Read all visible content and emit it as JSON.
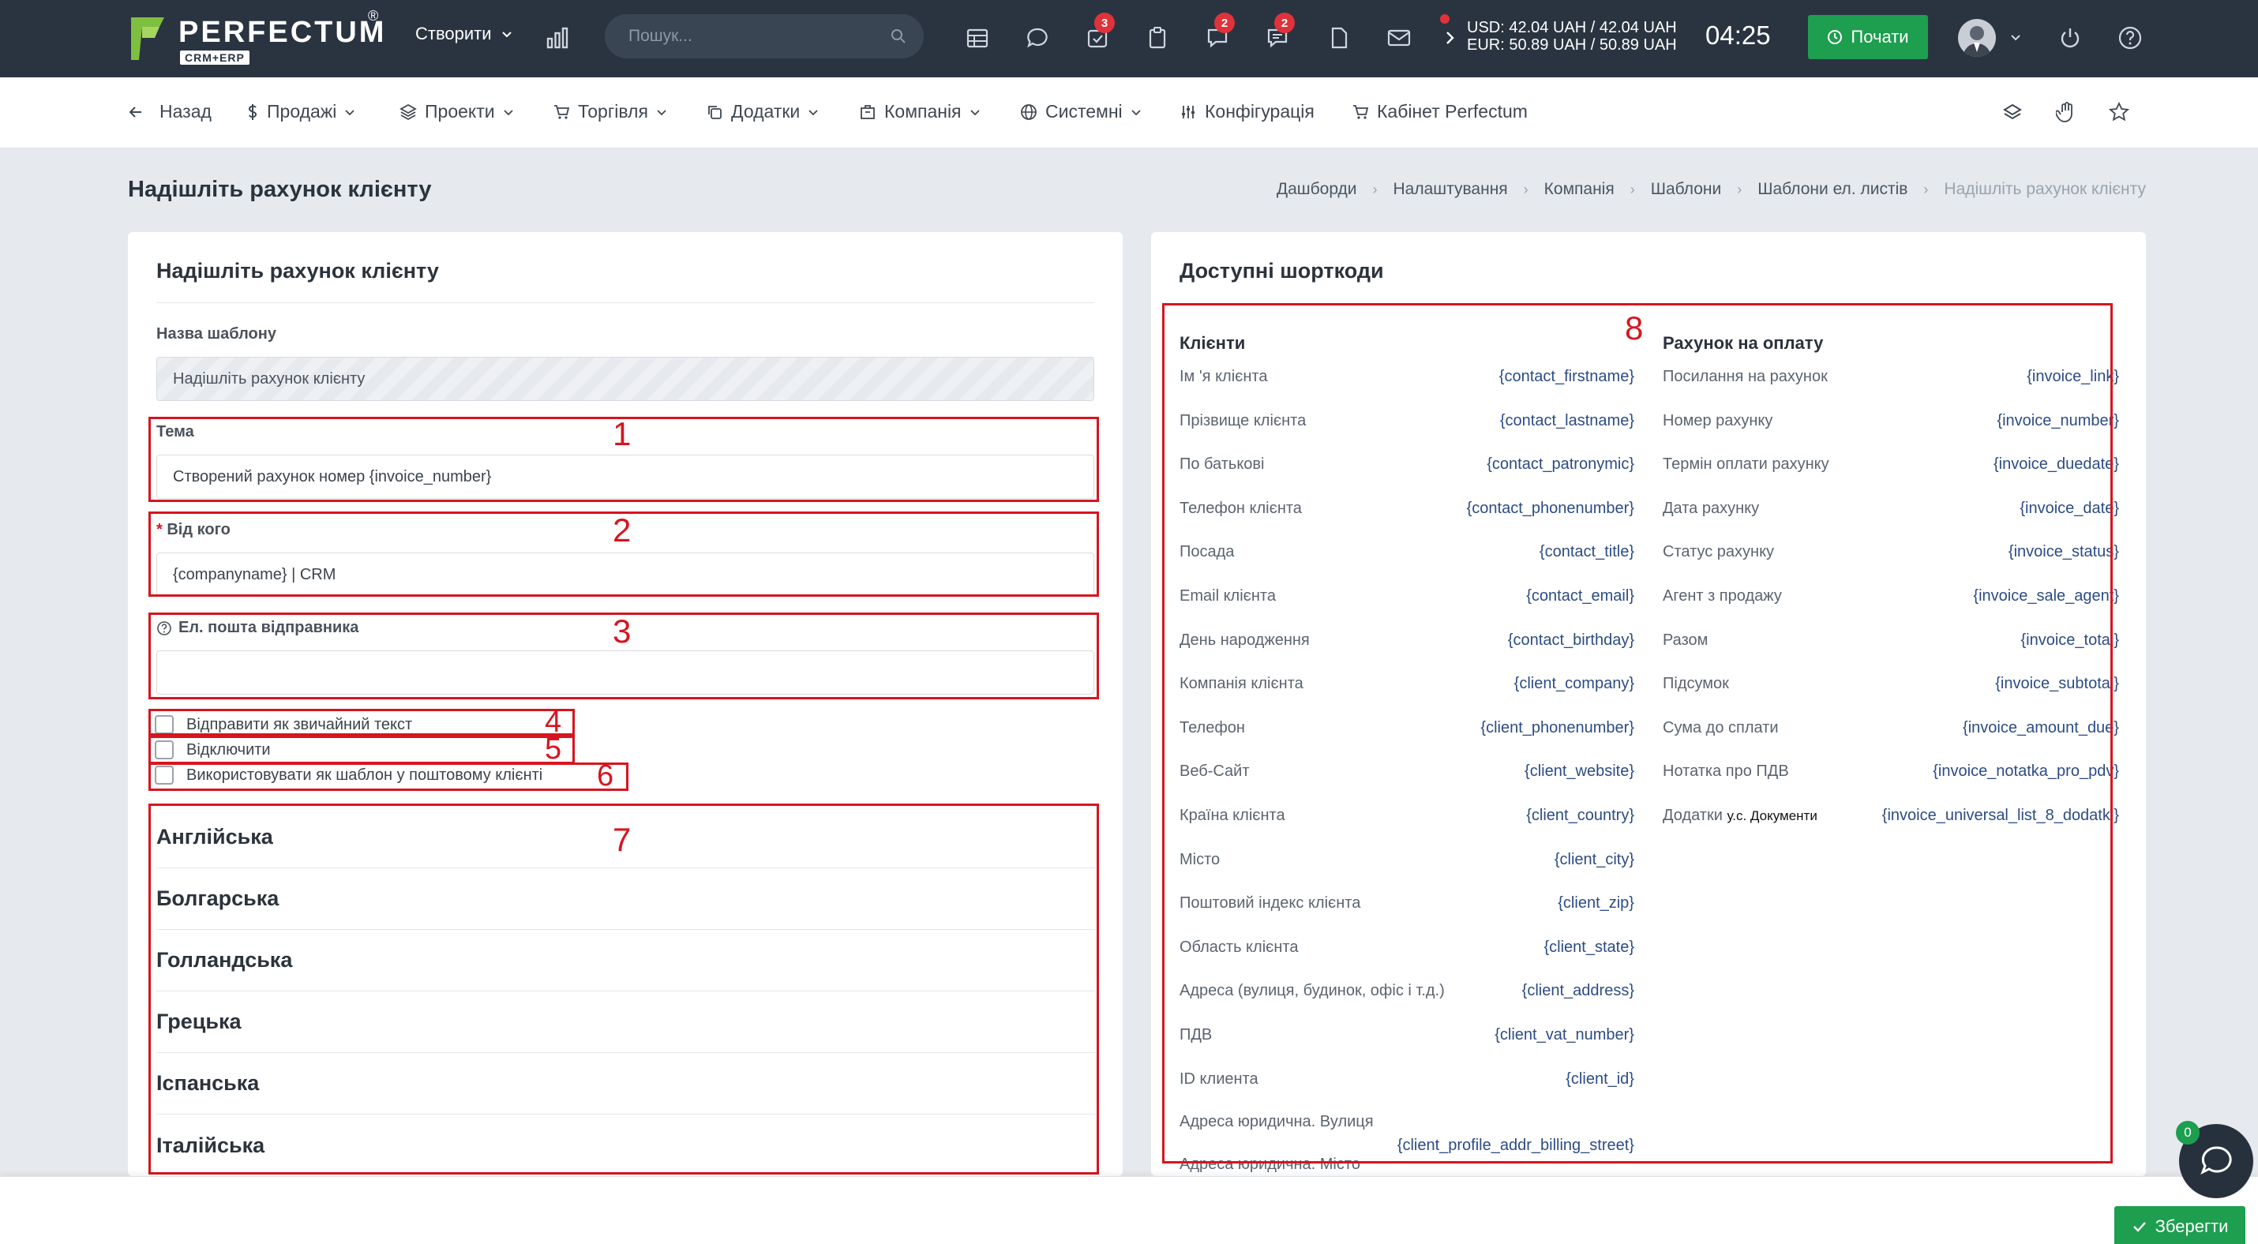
{
  "topbar": {
    "logo": "PERFECTUM",
    "logo_reg": "®",
    "logo_sub": "CRM+ERP",
    "create_label": "Створити",
    "search_placeholder": "Пошук...",
    "badges": {
      "tasks": "3",
      "chat1": "2",
      "chat2": "2"
    },
    "currency_usd": "USD: 42.04 UAH / 42.04 UAH",
    "currency_eur": "EUR: 50.89 UAH / 50.89 UAH",
    "time": "04:25",
    "start_label": "Почати"
  },
  "nav": {
    "back": "Назад",
    "sales": "Продажі",
    "projects": "Проекти",
    "trade": "Торгівля",
    "addons": "Додатки",
    "company": "Компанія",
    "system": "Системні",
    "config": "Конфігурація",
    "cabinet": "Кабінет Perfectum"
  },
  "page": {
    "title": "Надішліть рахунок клієнту",
    "breadcrumb": [
      "Дашборди",
      "Налаштування",
      "Компанія",
      "Шаблони",
      "Шаблони ел. листів",
      "Надішліть рахунок клієнту"
    ]
  },
  "form": {
    "card_title": "Надішліть рахунок клієнту",
    "template_name_label": "Назва шаблону",
    "template_name_value": "Надішліть рахунок клієнту",
    "subject_label": "Тема",
    "subject_value": "Створений рахунок номер {invoice_number}",
    "from_required": "*",
    "from_label": "Від кого",
    "from_value": "{companyname} | CRM",
    "sender_email_label": "Ел. пошта відправника",
    "sender_email_value": "",
    "check_plain": "Відправити як звичайний текст",
    "check_disable": "Відключити",
    "check_template": "Використовувати як шаблон у поштовому клієнті",
    "languages": [
      "Англійська",
      "Болгарська",
      "Голландська",
      "Грецька",
      "Іспанська",
      "Італійська"
    ]
  },
  "annotations": [
    "1",
    "2",
    "3",
    "4",
    "5",
    "6",
    "7",
    "8"
  ],
  "shortcodes": {
    "card_title": "Доступні шорткоди",
    "clients_heading": "Клієнти",
    "clients": [
      {
        "label": "Ім 'я клієнта",
        "code": "{contact_firstname}"
      },
      {
        "label": "Прізвище клієнта",
        "code": "{contact_lastname}"
      },
      {
        "label": "По батькові",
        "code": "{contact_patronymic}"
      },
      {
        "label": "Телефон клієнта",
        "code": "{contact_phonenumber}"
      },
      {
        "label": "Посада",
        "code": "{contact_title}"
      },
      {
        "label": "Email клієнта",
        "code": "{contact_email}"
      },
      {
        "label": "День народження",
        "code": "{contact_birthday}"
      },
      {
        "label": "Компанія клієнта",
        "code": "{client_company}"
      },
      {
        "label": "Телефон",
        "code": "{client_phonenumber}"
      },
      {
        "label": "Веб-Сайт",
        "code": "{client_website}"
      },
      {
        "label": "Країна клієнта",
        "code": "{client_country}"
      },
      {
        "label": "Місто",
        "code": "{client_city}"
      },
      {
        "label": "Поштовий індекс клієнта",
        "code": "{client_zip}"
      },
      {
        "label": "Область клієнта",
        "code": "{client_state}"
      },
      {
        "label": "Адреса (вулиця, будинок, офіс і т.д.)",
        "code": "{client_address}"
      },
      {
        "label": "ПДВ",
        "code": "{client_vat_number}"
      },
      {
        "label": "ID клиента",
        "code": "{client_id}"
      }
    ],
    "client_street_label": "Адреса юридична. Вулиця",
    "client_street_code": "{client_profile_addr_billing_street}",
    "client_city_label": "Адреса юридична. Місто",
    "invoice_heading": "Рахунок на оплату",
    "invoice": [
      {
        "label": "Посилання на рахунок",
        "code": "{invoice_link}"
      },
      {
        "label": "Номер рахунку",
        "code": "{invoice_number}"
      },
      {
        "label": "Термін оплати рахунку",
        "code": "{invoice_duedate}"
      },
      {
        "label": "Дата рахунку",
        "code": "{invoice_date}"
      },
      {
        "label": "Статус рахунку",
        "code": "{invoice_status}"
      },
      {
        "label": "Агент з продажу",
        "code": "{invoice_sale_agent}"
      },
      {
        "label": "Разом",
        "code": "{invoice_total}"
      },
      {
        "label": "Підсумок",
        "code": "{invoice_subtotal}"
      },
      {
        "label": "Сума до сплати",
        "code": "{invoice_amount_due}"
      },
      {
        "label": "Нотатка про ПДВ",
        "code": "{invoice_notatka_pro_pdv}"
      }
    ],
    "invoice_addon_label": "Додатки",
    "invoice_addon_sub": "у.с. Документи",
    "invoice_addon_code": "{invoice_universal_list_8_dodatki}"
  },
  "footer": {
    "save_label": "Зберегти",
    "chat_count": "0"
  },
  "colors": {
    "topbar": "#2a3441",
    "accent_green": "#1e9e4f",
    "annotation_red": "#d7151f",
    "badge_red": "#e0323a",
    "code_blue": "#2c4c86"
  }
}
